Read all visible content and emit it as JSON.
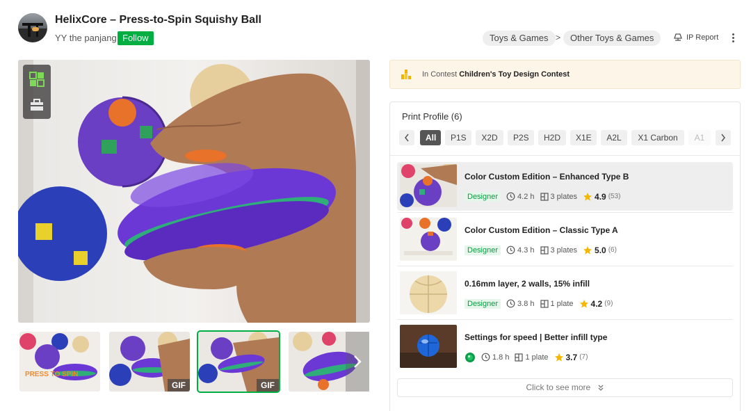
{
  "header": {
    "title": "HelixCore – Press-to-Spin Squishy Ball",
    "author": "YY the panjang",
    "follow_label": "Follow",
    "breadcrumbs": [
      "Toys & Games",
      ">",
      "Other Toys & Games"
    ],
    "ip_report": "IP Report"
  },
  "gallery": {
    "thumbs": [
      {
        "overlay": "PRESS TO SPIN"
      },
      {
        "badge": "GIF"
      },
      {
        "badge": "GIF"
      },
      {
        "badge": ""
      }
    ]
  },
  "contest": {
    "prefix": "In Contest",
    "name": "Children's Toy Design Contest"
  },
  "print_profile": {
    "title": "Print Profile (6)",
    "filters": [
      "All",
      "P1S",
      "X2D",
      "P2S",
      "H2D",
      "X1E",
      "A2L",
      "X1 Carbon",
      "A1"
    ],
    "active_filter": "All",
    "items": [
      {
        "name": "Color Custom Edition – Enhanced Type B",
        "badge": "Designer",
        "time": "4.2 h",
        "plates": "3 plates",
        "rating": "4.9",
        "count": "(53)"
      },
      {
        "name": "Color Custom Edition – Classic Type A",
        "badge": "Designer",
        "time": "4.3 h",
        "plates": "3 plates",
        "rating": "5.0",
        "count": "(6)"
      },
      {
        "name": "0.16mm layer, 2 walls, 15% infill",
        "badge": "Designer",
        "time": "3.8 h",
        "plates": "1 plate",
        "rating": "4.2",
        "count": "(9)"
      },
      {
        "name": "Settings for speed | Better infill type",
        "badge": "",
        "time": "1.8 h",
        "plates": "1 plate",
        "rating": "3.7",
        "count": "(7)"
      }
    ],
    "see_more": "Click to see more"
  },
  "colors": {
    "accent": "#00ae42",
    "star": "#f5b800"
  }
}
